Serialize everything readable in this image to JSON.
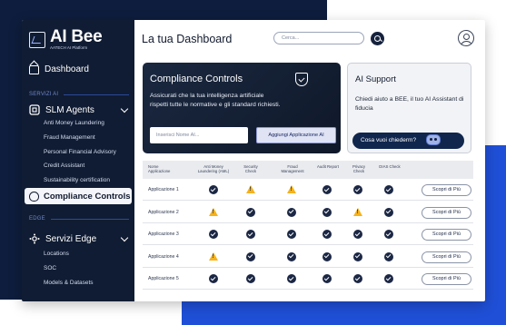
{
  "brand": {
    "name": "AI Bee",
    "tagline": "AATECH AI Platform"
  },
  "sidebar": {
    "dashboard": "Dashboard",
    "section_ai": "SERVIZI AI",
    "slm_group": "SLM Agents",
    "slm_items": [
      "Anti Money Laundering",
      "Fraud Management",
      "Personal Financial Advisory",
      "Credit Assistant",
      "Sustainability certification"
    ],
    "active_item": "Compliance Controls",
    "section_edge": "EDGE",
    "edge_group": "Servizi Edge",
    "edge_items": [
      "Locations",
      "SOC",
      "Models & Datasets"
    ]
  },
  "header": {
    "title": "La tua Dashboard",
    "search_placeholder": "Cerca..."
  },
  "compliance": {
    "title": "Compliance Controls",
    "description": "Assicurati che la tua intelligenza artificiale rispetti tutte le normative e gli standard richiesti.",
    "input_placeholder": "Inserisci Nome AI...",
    "button": "Aggiungi Applicazione AI"
  },
  "ai_support": {
    "title": "AI Support",
    "description": "Chiedi aiuto a BEE, il tuo AI Assistant di fiducia",
    "button": "Cosa vuoi chiederm?"
  },
  "table": {
    "headers": [
      "Nome Applicazione",
      "Anti Money Laundering (AML)",
      "Security Check",
      "Fraud Management",
      "Audit Report",
      "Privacy Check",
      "DIAS Check"
    ],
    "more_label": "Scopri di Più",
    "rows": [
      {
        "name": "Applicazione 1",
        "status": [
          "ok",
          "warn",
          "warn",
          "ok",
          "ok",
          "ok"
        ]
      },
      {
        "name": "Applicazione 2",
        "status": [
          "warn",
          "ok",
          "ok",
          "ok",
          "warn",
          "ok"
        ]
      },
      {
        "name": "Applicazione 3",
        "status": [
          "ok",
          "ok",
          "ok",
          "ok",
          "ok",
          "ok"
        ]
      },
      {
        "name": "Applicazione 4",
        "status": [
          "warn",
          "ok",
          "ok",
          "ok",
          "ok",
          "ok"
        ]
      },
      {
        "name": "Applicazione 5",
        "status": [
          "ok",
          "ok",
          "ok",
          "ok",
          "ok",
          "ok"
        ]
      }
    ]
  },
  "colors": {
    "sidebar_bg": "#101c33",
    "accent_blue": "#1f4fd6",
    "warning": "#f5b21b",
    "ok_icon": "#1b2744"
  }
}
